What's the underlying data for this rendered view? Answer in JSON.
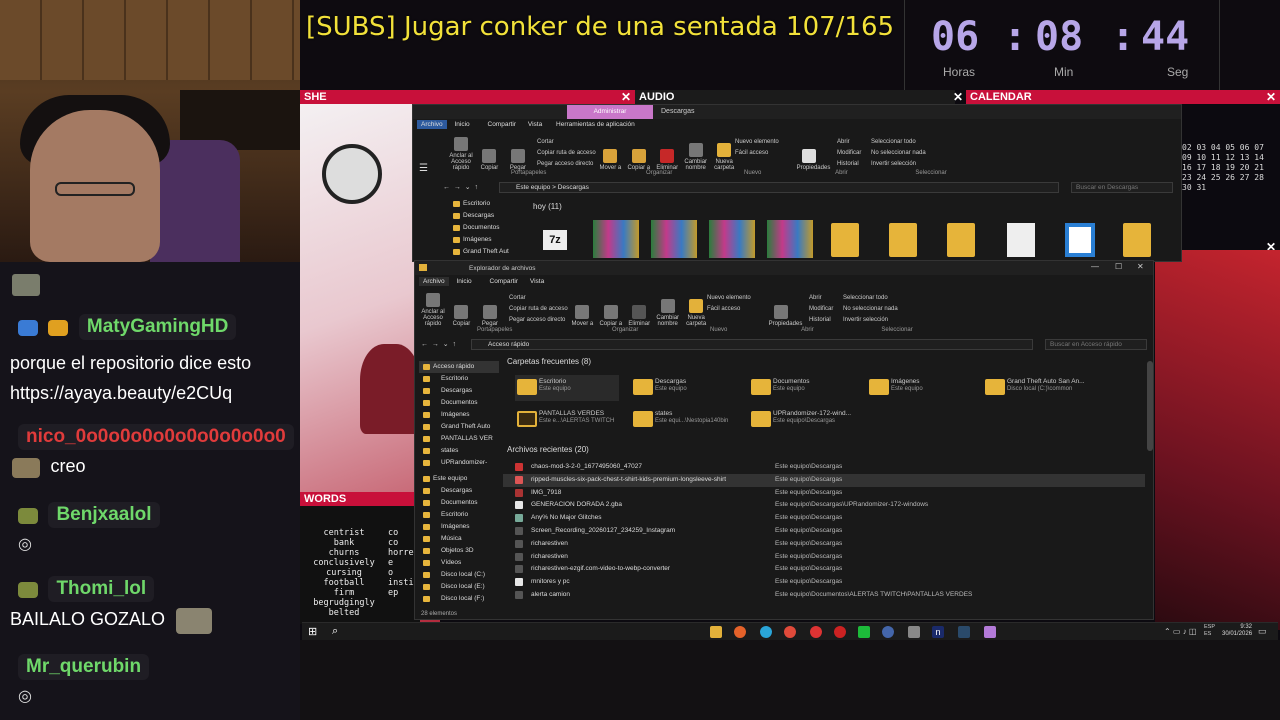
{
  "stream": {
    "title": "[SUBS] Jugar conker de una sentada 107/165",
    "clock": {
      "hours": "06",
      "minutes": "08",
      "seconds": "44",
      "sep": ":",
      "hours_label": "Horas",
      "minutes_label": "Min",
      "seconds_label": "Seg"
    },
    "panels": {
      "she": "SHE",
      "audio": "AUDIO",
      "calendar": "CALENDAR",
      "words": "WORDS"
    },
    "calendar_numbers": [
      "02 03 04 05 06 07",
      "09 10 11 12 13 14",
      "16 17 18 19 20 21",
      "23 24 25 26 27 28",
      "30 31"
    ],
    "words": [
      "centrist",
      "bank",
      "churns",
      "conclusively",
      "cursing",
      "football",
      "firm",
      "begrudgingly",
      "belted"
    ],
    "words_right": [
      "co",
      "co",
      "horre",
      "e",
      "o",
      "instir",
      "ep"
    ]
  },
  "chat": {
    "messages": [
      {
        "user": "MatyGamingHD",
        "user_color": "#6fd86a",
        "text": "porque el repositorio dice esto https://ayaya.beauty/e2CUq"
      },
      {
        "user": "nico_0o0o0o0o0o0o0o0o0o0",
        "user_color": "#e03b3b",
        "text": "creo"
      },
      {
        "user": "Benjxaalol",
        "user_color": "#6fd86a",
        "text": ""
      },
      {
        "user": "Thomi_lol",
        "user_color": "#6fd86a",
        "text": "BAILALO GOZALO"
      },
      {
        "user": "Mr_querubin",
        "user_color": "#6fd86a",
        "text": ""
      }
    ]
  },
  "back_window": {
    "quick_tabs": [
      "Administrar",
      "Descargas"
    ],
    "menu": [
      "Archivo",
      "Inicio",
      "Compartir",
      "Vista",
      "Herramientas de aplicación"
    ],
    "ribbon": [
      "Anclar al Acceso rápido",
      "Copiar",
      "Pegar",
      "Mover a",
      "Copiar a",
      "Eliminar",
      "Cambiar nombre",
      "Nueva carpeta",
      "Propiedades"
    ],
    "ribbon_small": [
      "Cortar",
      "Copiar ruta de acceso",
      "Pegar acceso directo",
      "Nuevo elemento",
      "Fácil acceso",
      "Abrir",
      "Modificar",
      "Historial",
      "Seleccionar todo",
      "No seleccionar nada",
      "Invertir selección"
    ],
    "groups": [
      "Portapapeles",
      "Organizar",
      "Nuevo",
      "Abrir",
      "Seleccionar"
    ],
    "path": [
      "Este equipo",
      "Descargas"
    ],
    "search_placeholder": "Buscar en Descargas",
    "nav": [
      "Escritorio",
      "Descargas",
      "Documentos",
      "Imágenes",
      "Grand Theft Aut"
    ],
    "section": "hoy (11)",
    "icon_7z": "7z"
  },
  "front_window": {
    "title": "Explorador de archivos",
    "menu": [
      "Archivo",
      "Inicio",
      "Compartir",
      "Vista"
    ],
    "ribbon": [
      "Anclar al Acceso rápido",
      "Copiar",
      "Pegar",
      "Mover a",
      "Copiar a",
      "Eliminar",
      "Cambiar nombre",
      "Nueva carpeta",
      "Propiedades"
    ],
    "ribbon_small": [
      "Cortar",
      "Copiar ruta de acceso",
      "Pegar acceso directo",
      "Nuevo elemento",
      "Fácil acceso",
      "Abrir",
      "Modificar",
      "Historial",
      "Seleccionar todo",
      "No seleccionar nada",
      "Invertir selección"
    ],
    "groups": [
      "Portapapeles",
      "Organizar",
      "Nuevo",
      "Abrir",
      "Seleccionar"
    ],
    "path": "Acceso rápido",
    "search_placeholder": "Buscar en Acceso rápido",
    "nav": [
      "Acceso rápido",
      "Escritorio",
      "Descargas",
      "Documentos",
      "Imágenes",
      "Grand Theft Auto",
      "PANTALLAS VER",
      "states",
      "UPRandomizer-",
      "Este equipo",
      "Descargas",
      "Documentos",
      "Escritorio",
      "Imágenes",
      "Música",
      "Objetos 3D",
      "Vídeos",
      "Disco local (C:)",
      "Disco local (E:)",
      "Disco local (F:)"
    ],
    "frequent_header": "Carpetas frecuentes (8)",
    "frequent": [
      {
        "name": "Escritorio",
        "sub": "Este equipo"
      },
      {
        "name": "Descargas",
        "sub": "Este equipo"
      },
      {
        "name": "Documentos",
        "sub": "Este equipo"
      },
      {
        "name": "Imágenes",
        "sub": "Este equipo"
      },
      {
        "name": "Grand Theft Auto San An...",
        "sub": "Disco local (C:)\\common"
      },
      {
        "name": "PANTALLAS VERDES",
        "sub": "Este e...\\ALERTAS TWITCH"
      },
      {
        "name": "states",
        "sub": "Este equi...\\Nestopia140bin"
      },
      {
        "name": "UPRandomizer-172-wind...",
        "sub": "Este equipo\\Descargas"
      }
    ],
    "recent_header": "Archivos recientes (20)",
    "recent": [
      {
        "name": "chaos-mod-3-2-0_1677495060_47027",
        "path": "Este equipo\\Descargas"
      },
      {
        "name": "ripped-muscles-six-pack-chest-t-shirt-kids-premium-longsleeve-shirt",
        "path": "Este equipo\\Descargas"
      },
      {
        "name": "IMG_7918",
        "path": "Este equipo\\Descargas"
      },
      {
        "name": "GENERACION DORADA 2.gba",
        "path": "Este equipo\\Descargas\\UPRandomizer-172-windows"
      },
      {
        "name": "Any% No Major Glitches",
        "path": "Este equipo\\Descargas"
      },
      {
        "name": "Screen_Recording_20260127_234259_Instagram",
        "path": "Este equipo\\Descargas"
      },
      {
        "name": "richarestiven",
        "path": "Este equipo\\Descargas"
      },
      {
        "name": "richarestiven",
        "path": "Este equipo\\Descargas"
      },
      {
        "name": "richarestiven-ezgif.com-video-to-webp-converter",
        "path": "Este equipo\\Descargas"
      },
      {
        "name": "mnitores y pc",
        "path": "Este equipo\\Descargas"
      },
      {
        "name": "alerta camion",
        "path": "Este equipo\\Documentos\\ALERTAS TWITCH\\PANTALLAS VERDES"
      }
    ],
    "status": "28 elementos"
  },
  "taskbar": {
    "lang": "ESP\nES",
    "time": "9:32",
    "date": "30/01/2026"
  }
}
